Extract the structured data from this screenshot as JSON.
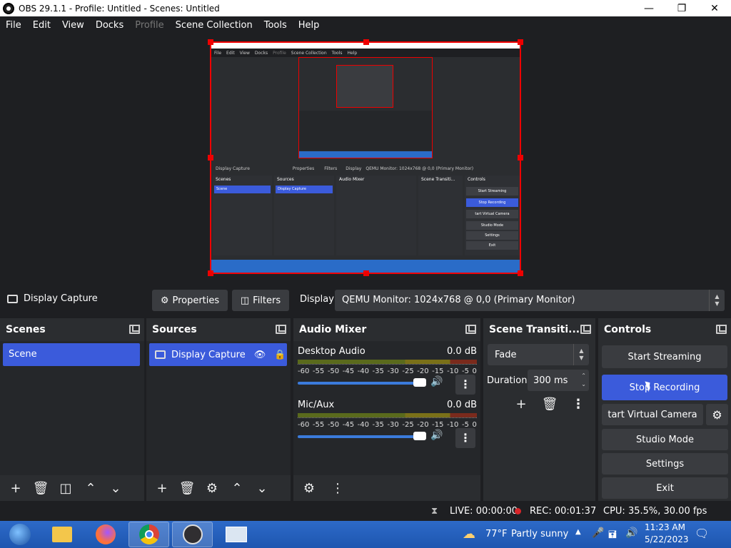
{
  "window": {
    "title": "OBS 29.1.1 - Profile: Untitled - Scenes: Untitled"
  },
  "menu": [
    {
      "label": "File",
      "disabled": false
    },
    {
      "label": "Edit",
      "disabled": false
    },
    {
      "label": "View",
      "disabled": false
    },
    {
      "label": "Docks",
      "disabled": false
    },
    {
      "label": "Profile",
      "disabled": true
    },
    {
      "label": "Scene Collection",
      "disabled": false
    },
    {
      "label": "Tools",
      "disabled": false
    },
    {
      "label": "Help",
      "disabled": false
    }
  ],
  "source_bar": {
    "source_name": "Display Capture",
    "properties_label": "Properties",
    "filters_label": "Filters",
    "display_label": "Display",
    "display_value": "QEMU Monitor: 1024x768 @ 0,0 (Primary Monitor)"
  },
  "scenes": {
    "title": "Scenes",
    "items": [
      "Scene"
    ]
  },
  "sources": {
    "title": "Sources",
    "items": [
      "Display Capture"
    ]
  },
  "mixer": {
    "title": "Audio Mixer",
    "scale": [
      "-60",
      "-55",
      "-50",
      "-45",
      "-40",
      "-35",
      "-30",
      "-25",
      "-20",
      "-15",
      "-10",
      "-5",
      "0"
    ],
    "channels": [
      {
        "name": "Desktop Audio",
        "db": "0.0 dB"
      },
      {
        "name": "Mic/Aux",
        "db": "0.0 dB"
      }
    ]
  },
  "transitions": {
    "title": "Scene Transiti...",
    "type": "Fade",
    "duration_label": "Duration",
    "duration_value": "300 ms"
  },
  "controls": {
    "title": "Controls",
    "start_streaming": "Start Streaming",
    "stop_recording": "Stop Recording",
    "start_virtual_camera": "tart Virtual Camera",
    "studio_mode": "Studio Mode",
    "settings": "Settings",
    "exit": "Exit"
  },
  "status": {
    "live": "LIVE: 00:00:00",
    "rec": "REC: 00:01:37",
    "cpu": "CPU: 35.5%, 30.00 fps"
  },
  "preview_mini": {
    "menu": [
      "File",
      "Edit",
      "View",
      "Docks",
      "Profile",
      "Scene Collection",
      "Tools",
      "Help"
    ],
    "display_value": "QEMU Monitor: 1024x768 @ 0,0 (Primary Monitor)"
  },
  "taskbar": {
    "weather_temp": "77°F",
    "weather_text": "Partly sunny",
    "time": "11:23 AM",
    "date": "5/22/2023"
  }
}
